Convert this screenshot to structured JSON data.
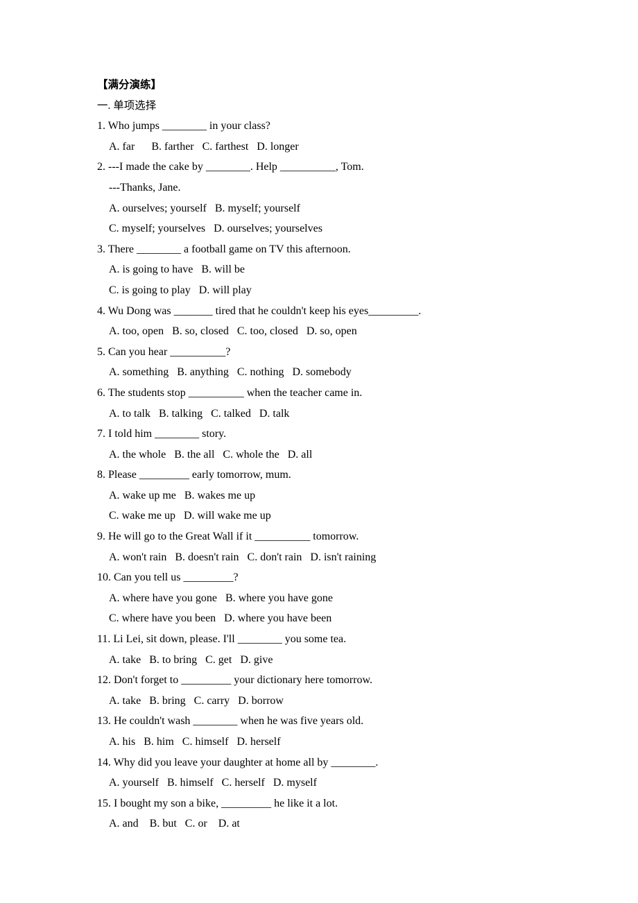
{
  "document": {
    "heading": "【满分演练】",
    "section_heading": "一. 单项选择",
    "questions": [
      {
        "stem": "1. Who jumps ________ in your class?",
        "lines": [
          "A. far      B. farther   C. farthest   D. longer"
        ]
      },
      {
        "stem": "2. ---I made the cake by ________. Help __________, Tom.",
        "lines": [
          "---Thanks, Jane.",
          "A. ourselves; yourself   B. myself; yourself",
          "C. myself; yourselves   D. ourselves; yourselves"
        ]
      },
      {
        "stem": "3. There ________ a football game on TV this afternoon.",
        "lines": [
          "A. is going to have   B. will be",
          "C. is going to play   D. will play"
        ]
      },
      {
        "stem": "4. Wu Dong was _______ tired that he couldn't keep his eyes_________.",
        "lines": [
          "A. too, open   B. so, closed   C. too, closed   D. so, open"
        ]
      },
      {
        "stem": "5. Can you hear __________?",
        "lines": [
          "A. something   B. anything   C. nothing   D. somebody"
        ]
      },
      {
        "stem": "6. The students stop __________ when the teacher came in.",
        "lines": [
          "A. to talk   B. talking   C. talked   D. talk"
        ]
      },
      {
        "stem": "7. I told him ________ story.",
        "lines": [
          "A. the whole   B. the all   C. whole the   D. all"
        ]
      },
      {
        "stem": "8. Please _________ early tomorrow, mum.",
        "lines": [
          "A. wake up me   B. wakes me up",
          "C. wake me up   D. will wake me up"
        ]
      },
      {
        "stem": "9. He will go to the Great Wall if it __________ tomorrow.",
        "lines": [
          "A. won't rain   B. doesn't rain   C. don't rain   D. isn't raining"
        ]
      },
      {
        "stem": "10. Can you tell us _________?",
        "lines": [
          "A. where have you gone   B. where you have gone",
          "C. where have you been   D. where you have been"
        ]
      },
      {
        "stem": "11. Li Lei, sit down, please. I'll ________ you some tea.",
        "lines": [
          "A. take   B. to bring   C. get   D. give"
        ]
      },
      {
        "stem": "12. Don't forget to _________ your dictionary here tomorrow.",
        "lines": [
          "A. take   B. bring   C. carry   D. borrow"
        ]
      },
      {
        "stem": "13. He couldn't wash ________ when he was five years old.",
        "lines": [
          "A. his   B. him   C. himself   D. herself"
        ]
      },
      {
        "stem": "14. Why did you leave your daughter at home all by ________.",
        "lines": [
          "A. yourself   B. himself   C. herself   D. myself"
        ]
      },
      {
        "stem": "15. I bought my son a bike, _________ he like it a lot.",
        "lines": [
          "A. and    B. but   C. or    D. at"
        ]
      }
    ]
  }
}
